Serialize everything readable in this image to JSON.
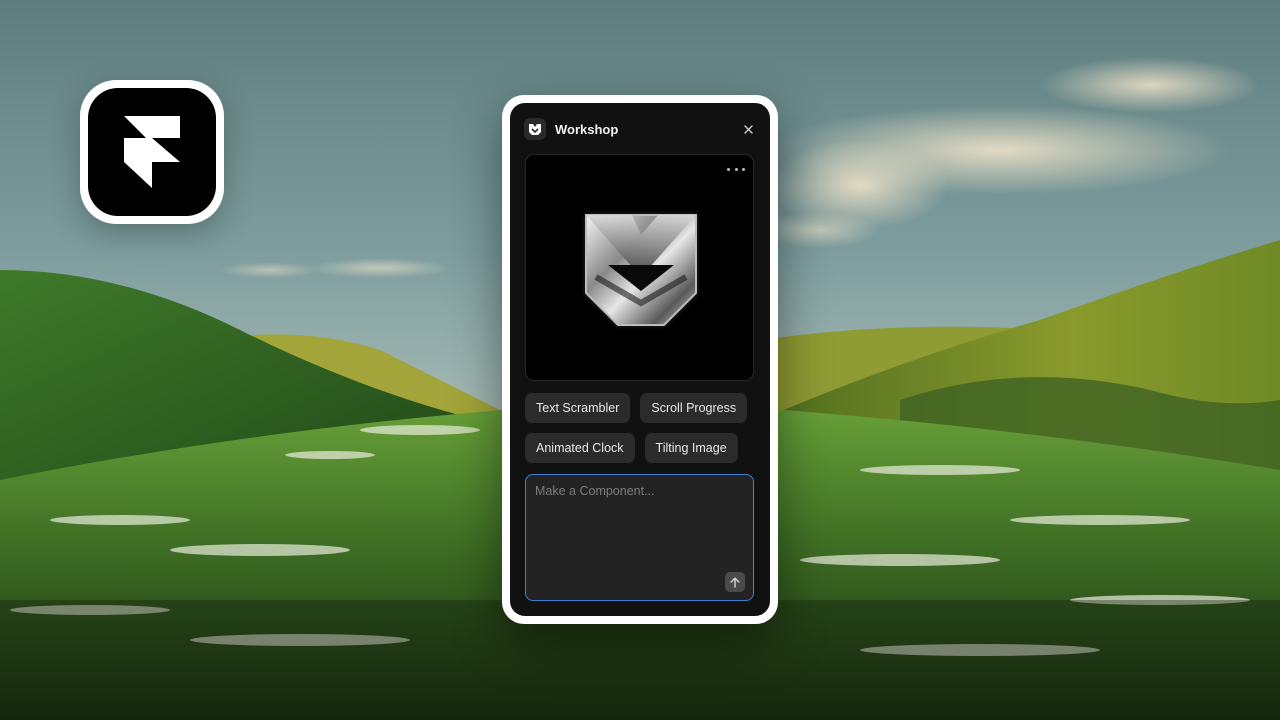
{
  "app_logo": {
    "icon": "framer-logo-icon"
  },
  "workshop": {
    "title": "Workshop",
    "badge_icon": "workshop-icon",
    "close_icon": "close-icon",
    "preview": {
      "more_icon": "more-horizontal-icon",
      "image_icon": "chrome-v-logo-icon"
    },
    "suggestions": [
      {
        "label": "Text Scrambler"
      },
      {
        "label": "Scroll Progress"
      },
      {
        "label": "Animated Clock"
      },
      {
        "label": "Tilting Image"
      }
    ],
    "composer": {
      "placeholder": "Make a Component...",
      "value": "",
      "send_icon": "arrow-up-icon"
    }
  },
  "colors": {
    "panel_bg": "#111111",
    "chip_bg": "#2b2b2b",
    "input_focus": "#3f7fd8",
    "frame": "#ffffff"
  }
}
